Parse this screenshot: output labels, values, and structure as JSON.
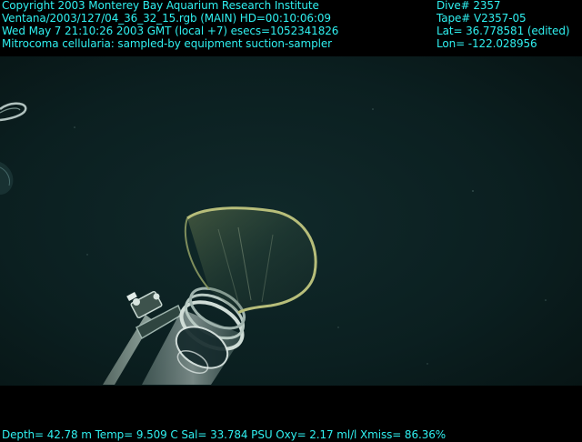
{
  "overlay": {
    "copyright": "Copyright 2003 Monterey Bay Aquarium Research Institute",
    "source_line": "Ventana/2003/127/04_36_32_15.rgb (MAIN)  HD=00:10:06:09",
    "time_line": "Wed May  7 21:10:26 2003 GMT (local +7)  esecs=1052341826",
    "annotation_line": "Mitrocoma cellularia: sampled-by equipment suction-sampler",
    "dive": "Dive# 2357",
    "tape": "Tape# V2357-05",
    "lat": "Lat= 36.778581 (edited)",
    "lon": "Lon= -122.028956",
    "sensors": "Depth= 42.78 m  Temp= 9.509 C  Sal= 33.784 PSU  Oxy= 2.17 ml/l  Xmiss= 86.36%"
  },
  "colors": {
    "overlay_text": "#2ff0f0",
    "water": "#0b1d1d",
    "letterbox": "#000000"
  }
}
